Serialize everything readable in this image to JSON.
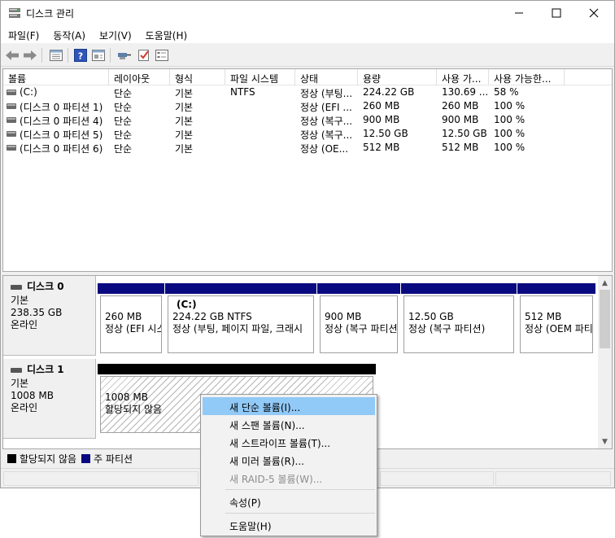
{
  "window": {
    "title": "디스크 관리",
    "controls": [
      "minimize",
      "maximize",
      "close"
    ]
  },
  "menu": [
    "파일(F)",
    "동작(A)",
    "보기(V)",
    "도움말(H)"
  ],
  "toolbar": [
    "back-icon",
    "forward-icon",
    "properties-list-icon",
    "help-icon",
    "show-hide-icon",
    "connect-icon",
    "check-icon",
    "settings-list-icon"
  ],
  "volume_list": {
    "columns": [
      "볼륨",
      "레이아웃",
      "형식",
      "파일 시스템",
      "상태",
      "용량",
      "사용 가...",
      "사용 가능한..."
    ],
    "rows": [
      [
        "(C:)",
        "단순",
        "기본",
        "NTFS",
        "정상 (부팅...",
        "224.22 GB",
        "130.69 ...",
        "58 %"
      ],
      [
        "(디스크 0 파티션 1)",
        "단순",
        "기본",
        "",
        "정상 (EFI ...",
        "260 MB",
        "260 MB",
        "100 %"
      ],
      [
        "(디스크 0 파티션 4)",
        "단순",
        "기본",
        "",
        "정상 (복구...",
        "900 MB",
        "900 MB",
        "100 %"
      ],
      [
        "(디스크 0 파티션 5)",
        "단순",
        "기본",
        "",
        "정상 (복구...",
        "12.50 GB",
        "12.50 GB",
        "100 %"
      ],
      [
        "(디스크 0 파티션 6)",
        "단순",
        "기본",
        "",
        "정상 (OE...",
        "512 MB",
        "512 MB",
        "100 %"
      ]
    ]
  },
  "disks": [
    {
      "name": "디스크 0",
      "type": "기본",
      "size": "238.35 GB",
      "status": "온라인",
      "partitions": [
        {
          "name": "",
          "size": "260 MB",
          "status": "정상 (EFI 시스"
        },
        {
          "name": "(C:)",
          "size": "224.22 GB NTFS",
          "status": "정상 (부팅, 페이지 파일, 크래시"
        },
        {
          "name": "",
          "size": "900 MB",
          "status": "정상 (복구 파티션"
        },
        {
          "name": "",
          "size": "12.50 GB",
          "status": "정상 (복구 파티션)"
        },
        {
          "name": "",
          "size": "512 MB",
          "status": "정상 (OEM 파티"
        }
      ]
    },
    {
      "name": "디스크 1",
      "type": "기본",
      "size": "1008 MB",
      "status": "온라인",
      "partitions": [
        {
          "name": "",
          "size": "1008 MB",
          "status": "할당되지 않음"
        }
      ]
    }
  ],
  "legend": [
    {
      "label": "할당되지 않음",
      "color": "#000000"
    },
    {
      "label": "주 파티션",
      "color": "#0a0a80"
    }
  ],
  "context_menu": {
    "items": [
      {
        "label": "새 단순 볼륨(I)...",
        "highlighted": true,
        "enabled": true
      },
      {
        "label": "새 스팬 볼륨(N)...",
        "enabled": true
      },
      {
        "label": "새 스트라이프 볼륨(T)...",
        "enabled": true
      },
      {
        "label": "새 미러 볼륨(R)...",
        "enabled": true
      },
      {
        "label": "새 RAID-5 볼륨(W)...",
        "enabled": false
      },
      {
        "label": "속성(P)",
        "enabled": true
      },
      {
        "label": "도움말(H)",
        "enabled": true
      }
    ]
  }
}
